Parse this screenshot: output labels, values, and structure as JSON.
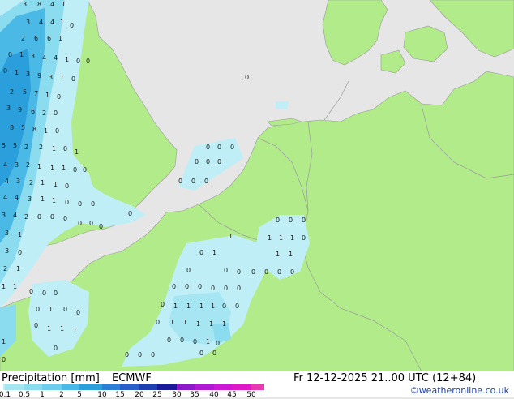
{
  "map": {
    "precip_cells": [
      "0",
      "1",
      "2",
      "3",
      "4",
      "5",
      "6",
      "7",
      "8",
      "9"
    ]
  },
  "footer": {
    "title": "Precipitation [mm]",
    "model": "ECMWF",
    "valid_time": "Fr 12-12-2025 21..00 UTC (12+84)",
    "credit": "©weatheronline.co.uk"
  },
  "legend": {
    "ticks": [
      "0.1",
      "0.5",
      "1",
      "2",
      "5",
      "10",
      "15",
      "20",
      "25",
      "30",
      "35",
      "40",
      "45",
      "50"
    ],
    "colors": [
      "#bfeef6",
      "#a6e6f3",
      "#8cdcf0",
      "#6ccdec",
      "#4ab9e6",
      "#2a9fdc",
      "#2b7fd4",
      "#2a5fca",
      "#1e3fb0",
      "#1a1a99",
      "#8a19c8",
      "#b019d2",
      "#cc19d6",
      "#e019c8",
      "#e83ab0"
    ]
  },
  "colors": {
    "sea": "#e6e6e6",
    "land": "#b2ec8a",
    "border": "#9a9a9a"
  }
}
